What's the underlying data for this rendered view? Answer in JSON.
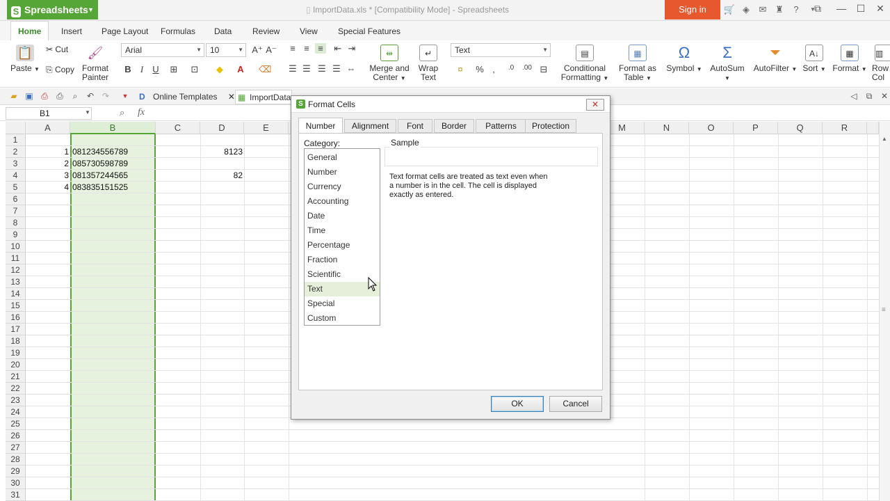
{
  "app": {
    "name": "Spreadsheets",
    "window_title": "ImportData.xls * [Compatibility Mode] - Spreadsheets",
    "sign_in": "Sign in"
  },
  "menu_tabs": [
    "Home",
    "Insert",
    "Page Layout",
    "Formulas",
    "Data",
    "Review",
    "View",
    "Special Features"
  ],
  "ribbon": {
    "paste": "Paste",
    "cut": "Cut",
    "copy": "Copy",
    "format_painter_1": "Format",
    "format_painter_2": "Painter",
    "font": "Arial",
    "size": "10",
    "number_format": "Text",
    "merge_1": "Merge and",
    "merge_2": "Center",
    "wrap_1": "Wrap",
    "wrap_2": "Text",
    "cond_1": "Conditional",
    "cond_2": "Formatting",
    "fmt_table_1": "Format as",
    "fmt_table_2": "Table",
    "symbol": "Symbol",
    "autosum": "AutoSum",
    "autofilter": "AutoFilter",
    "sort": "Sort",
    "format": "Format",
    "row_col_1": "Row",
    "row_col_2": "Col"
  },
  "quick_bar": {
    "online_templates": "Online Templates",
    "doc_tab": "ImportData.xl"
  },
  "formula_bar": {
    "name_box": "B1",
    "fx": "fx"
  },
  "grid": {
    "columns": [
      "A",
      "B",
      "C",
      "D",
      "E",
      "M",
      "N",
      "O",
      "P",
      "Q",
      "R"
    ],
    "rows": [
      "1",
      "2",
      "3",
      "4",
      "5",
      "6",
      "7",
      "8",
      "9",
      "10",
      "11",
      "12",
      "13",
      "14",
      "15",
      "16",
      "17",
      "18",
      "19",
      "20",
      "21",
      "22",
      "23",
      "24",
      "25",
      "26",
      "27",
      "28",
      "29",
      "30",
      "31"
    ],
    "cells": {
      "a2": "1",
      "a3": "2",
      "a4": "3",
      "a5": "4",
      "b2": "081234556789",
      "b3": "085730598789",
      "b4": "081357244565",
      "b5": "083835151525",
      "d2": "8123",
      "d4": "82"
    }
  },
  "dialog": {
    "title": "Format Cells",
    "tabs": [
      "Number",
      "Alignment",
      "Font",
      "Border",
      "Patterns",
      "Protection"
    ],
    "category_label": "Category:",
    "categories": [
      "General",
      "Number",
      "Currency",
      "Accounting",
      "Date",
      "Time",
      "Percentage",
      "Fraction",
      "Scientific",
      "Text",
      "Special",
      "Custom"
    ],
    "selected_category": "Text",
    "sample_label": "Sample",
    "description": "Text format cells are treated as text even when a number is in the cell. The cell is displayed exactly as entered.",
    "ok": "OK",
    "cancel": "Cancel"
  },
  "colors": {
    "accent": "#55a537",
    "signin": "#e8582f",
    "selection": "#e6f1de"
  }
}
